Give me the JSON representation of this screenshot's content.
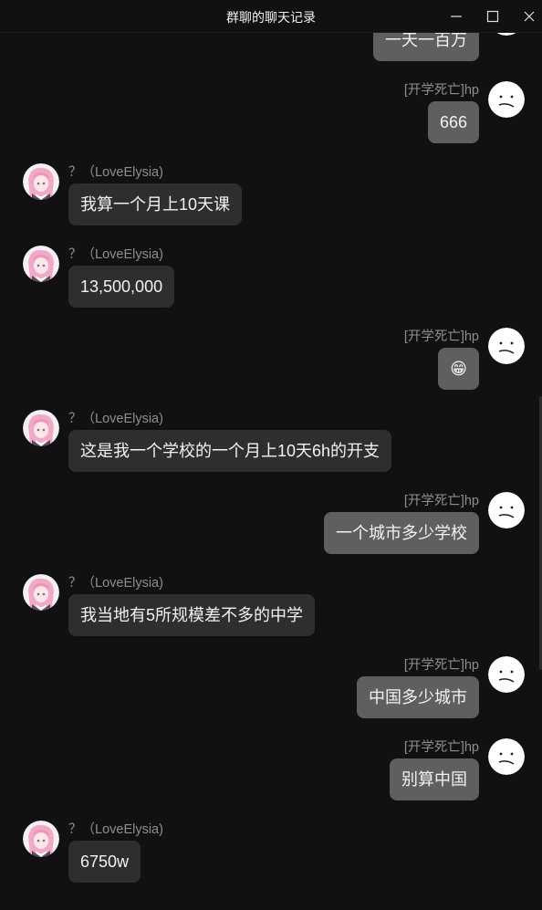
{
  "window": {
    "title": "群聊的聊天记录"
  },
  "users": {
    "left": {
      "name": "？（LoveElysia)"
    },
    "right": {
      "name": "[开学死亡]hp"
    }
  },
  "messages": [
    {
      "side": "right",
      "text": "一天一百万",
      "show_name": false
    },
    {
      "side": "right",
      "text": "666",
      "show_name": true
    },
    {
      "side": "left",
      "text": "我算一个月上10天课",
      "show_name": true
    },
    {
      "side": "left",
      "text": "13,500,000",
      "show_name": true
    },
    {
      "side": "right",
      "text": "😁",
      "show_name": true
    },
    {
      "side": "left",
      "text": "这是我一个学校的一个月上10天6h的开支",
      "show_name": true
    },
    {
      "side": "right",
      "text": "一个城市多少学校",
      "show_name": true
    },
    {
      "side": "left",
      "text": "我当地有5所规模差不多的中学",
      "show_name": true
    },
    {
      "side": "right",
      "text": "中国多少城市",
      "show_name": true
    },
    {
      "side": "right",
      "text": "别算中国",
      "show_name": true
    },
    {
      "side": "left",
      "text": "6750w",
      "show_name": true
    }
  ]
}
